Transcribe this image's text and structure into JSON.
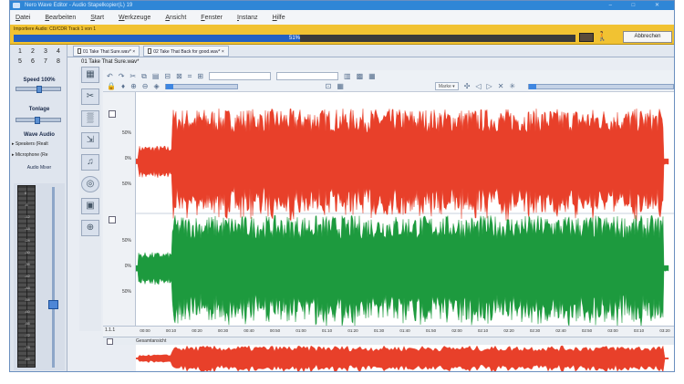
{
  "window": {
    "title": "Nero Wave Editor - Audio Stapelkopier(L) 19",
    "controls": "–  □  ✕"
  },
  "menu": [
    "Datei",
    "Bearbeiten",
    "Start",
    "Werkzeuge",
    "Ansicht",
    "Fenster",
    "Instanz",
    "Hilfe"
  ],
  "progress": {
    "label": "Importiere Audio: CD/CDR Track 1 von 1",
    "fraction": 0.51,
    "percent_text": "51%",
    "abort_label": "Abbrechen"
  },
  "left_panel": {
    "track_numbers": [
      "1",
      "2",
      "3",
      "4",
      "5",
      "6",
      "7",
      "8"
    ],
    "speed_label": "Speed 100%",
    "speed_value": 0.5,
    "tonlage_label": "Tonlage",
    "tonlage_value": 0.45,
    "wave_audio_label": "Wave Audio",
    "wave_audio_items": [
      "▸ Speakers (Realt",
      "▸ Microphone (Re"
    ],
    "audio_mixer_label": "Audio Mixer",
    "meter_scale": [
      "0",
      "-6",
      "-12",
      "-18",
      "-24",
      "-30",
      "-36",
      "-42",
      "-48",
      "-54",
      "-60",
      "-66",
      "-72",
      "-78",
      "-84"
    ]
  },
  "tabs": [
    {
      "label": "01 Take That Sure.wav*",
      "close": "×"
    },
    {
      "label": "02 Take That Back for good.wav*",
      "close": "×"
    }
  ],
  "document": {
    "filename": "01 Take That Sure.wav*"
  },
  "toolbar": {
    "mode_select": "Marke ▾"
  },
  "channels": {
    "db_labels_top": [
      "50%",
      "0%",
      "50%"
    ],
    "db_labels_bottom": [
      "50%",
      "0%",
      "50%"
    ],
    "top_color": "#e8402a",
    "bottom_color": "#1d9a3e"
  },
  "timeline": {
    "ticks": [
      "00:00",
      "00:10",
      "00:20",
      "00:30",
      "00:40",
      "00:50",
      "01:00",
      "01:10",
      "01:20",
      "01:30",
      "01:40",
      "01:50",
      "02:00",
      "02:10",
      "02:20",
      "02:30",
      "02:40",
      "02:50",
      "03:00",
      "03:10",
      "03:20"
    ],
    "zoom_label": "1.1.1"
  },
  "overview": {
    "label": "Gesamtansicht"
  }
}
